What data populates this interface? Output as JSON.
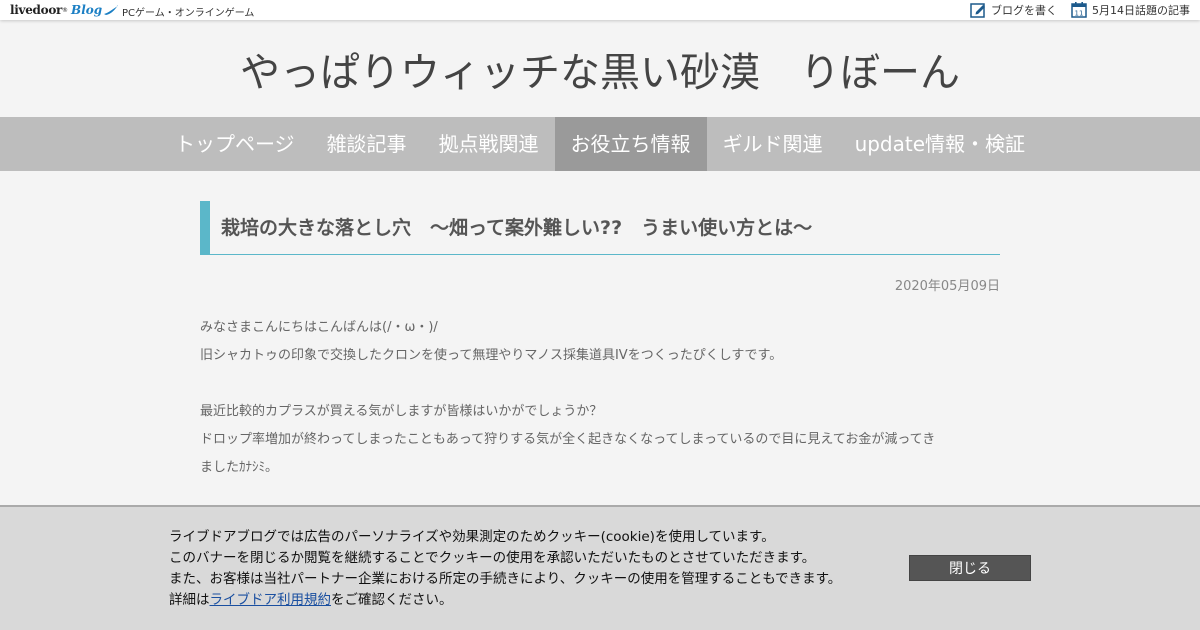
{
  "topbar": {
    "logo_text": "livedoor",
    "logo_reg": "®",
    "logo_blog": "Blog",
    "category": "PCゲーム・オンラインゲーム",
    "write_blog": "ブログを書く",
    "calendar_day": "11",
    "topic_link": "5月14日話題の記事"
  },
  "header": {
    "title": "やっぱりウィッチな黒い砂漠　りぼーん"
  },
  "nav": {
    "items": [
      {
        "label": "トップページ"
      },
      {
        "label": "雑談記事"
      },
      {
        "label": "拠点戦関連"
      },
      {
        "label": "お役立ち情報"
      },
      {
        "label": "ギルド関連"
      },
      {
        "label": "update情報・検証"
      }
    ],
    "active_index": 3
  },
  "article": {
    "title": "栽培の大きな落とし穴　～畑って案外難しい??　うまい使い方とは～",
    "date": "2020年05月09日",
    "lines": [
      "みなさまこんにちはこんばんは(/・ω・)/",
      "旧シャカトゥの印象で交換したクロンを使って無理やりマノス採集道具IVをつくったぴくしすです。",
      "最近比較的カプラスが買える気がしますが皆様はいかがでしょうか？",
      "ドロップ率増加が終わってしまったこともあって狩りする気が全く起きなくなってしまっているので目に見えてお金が減ってき",
      "ましたｶﾅｼﾐ。"
    ]
  },
  "cookie": {
    "line1": "ライブドアブログでは広告のパーソナライズや効果測定のためクッキー(cookie)を使用しています。",
    "line2": "このバナーを閉じるか閲覧を継続することでクッキーの使用を承認いただいたものとさせていただきます。",
    "line3": "また、お客様は当社パートナー企業における所定の手続きにより、クッキーの使用を管理することもできます。",
    "line4_prefix": "詳細は",
    "line4_link": "ライブドア利用規約",
    "line4_suffix": "をご確認ください。",
    "close_label": "閉じる"
  },
  "colors": {
    "accent": "#5bb7c9",
    "nav_bg": "#bdbdbd",
    "nav_active": "#9a9a9a",
    "brand_blue": "#1b7fc4"
  }
}
